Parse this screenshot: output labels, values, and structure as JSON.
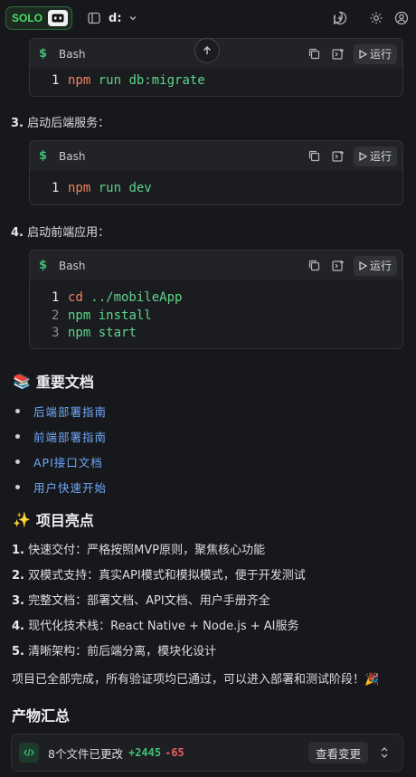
{
  "topbar": {
    "solo_label": "SOLO",
    "drive_label": "d:"
  },
  "code_blocks": [
    {
      "lang": "Bash",
      "run_label": "运行",
      "lines": [
        {
          "no": "1",
          "cmd": "npm",
          "args": " run db:migrate"
        }
      ]
    },
    {
      "lang": "Bash",
      "run_label": "运行",
      "lines": [
        {
          "no": "1",
          "cmd": "npm",
          "args": " run dev"
        }
      ]
    },
    {
      "lang": "Bash",
      "run_label": "运行",
      "lines": [
        {
          "no": "1",
          "cmd": "cd",
          "args": " ../mobileApp"
        },
        {
          "no": "2",
          "cmd": "npm",
          "args": " install"
        },
        {
          "no": "3",
          "cmd": "npm",
          "args": " start"
        }
      ]
    }
  ],
  "steps": [
    {
      "num": "3.",
      "text": "启动后端服务："
    },
    {
      "num": "4.",
      "text": "启动前端应用："
    }
  ],
  "docs": {
    "emoji": "📚",
    "title": "重要文档",
    "links": [
      "后端部署指南",
      "前端部署指南",
      "API接口文档",
      "用户快速开始"
    ]
  },
  "highlights": {
    "emoji": "✨",
    "title": "项目亮点",
    "items": [
      {
        "num": "1.",
        "text": "快速交付：严格按照MVP原则，聚焦核心功能"
      },
      {
        "num": "2.",
        "text": "双模式支持：真实API模式和模拟模式，便于开发测试"
      },
      {
        "num": "3.",
        "text": "完整文档：部署文档、API文档、用户手册齐全"
      },
      {
        "num": "4.",
        "text": "现代化技术栈：React Native + Node.js + AI服务"
      },
      {
        "num": "5.",
        "text": "清晰架构：前后端分离，模块化设计"
      }
    ]
  },
  "completion_text": "项目已全部完成，所有验证项均已通过，可以进入部署和测试阶段！🎉",
  "artifacts": {
    "title": "产物汇总",
    "changed_label": "8个文件已更改",
    "additions": "+2445",
    "deletions": "-65",
    "view_label": "查看变更"
  },
  "colors": {
    "accent_green": "#3fbf74",
    "link_blue": "#6fa8f7",
    "deletion_red": "#ef5b5b"
  }
}
